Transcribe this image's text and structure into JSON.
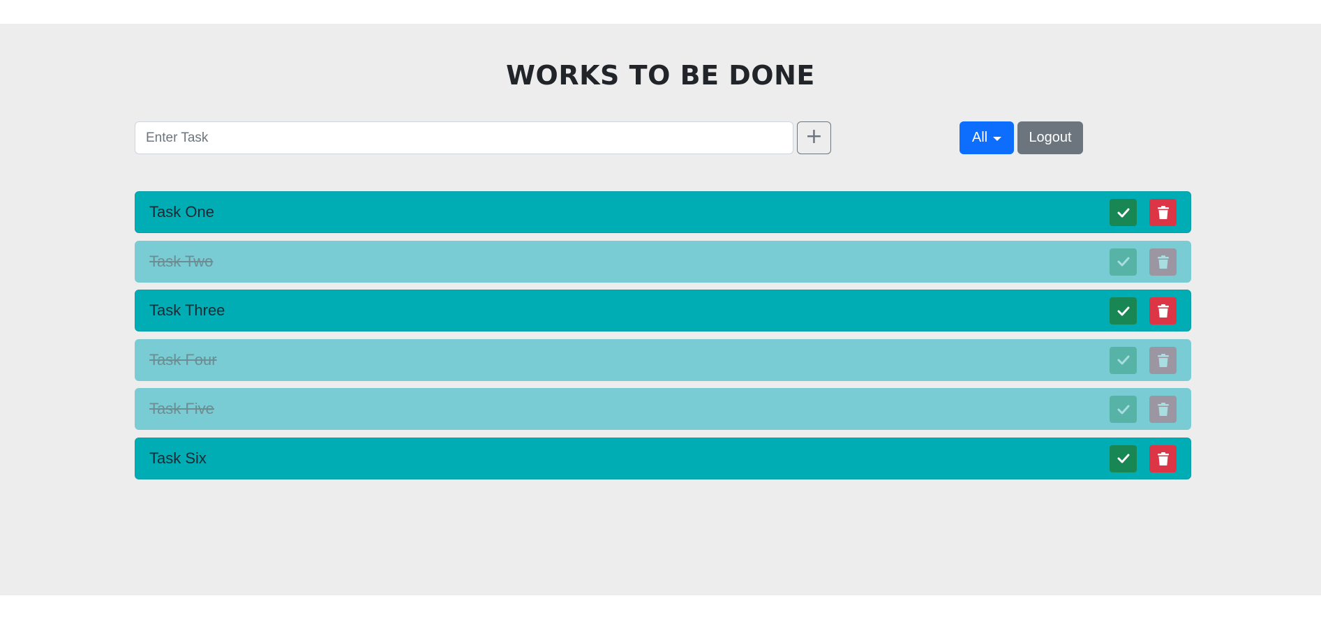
{
  "header": {
    "title": "WORKS TO BE DONE"
  },
  "input": {
    "placeholder": "Enter Task",
    "value": ""
  },
  "toolbar": {
    "add_label": "+",
    "filter_label": "All",
    "logout_label": "Logout"
  },
  "tasks": [
    {
      "label": "Task One",
      "done": false
    },
    {
      "label": "Task Two",
      "done": true
    },
    {
      "label": "Task Three",
      "done": false
    },
    {
      "label": "Task Four",
      "done": true
    },
    {
      "label": "Task Five",
      "done": true
    },
    {
      "label": "Task Six",
      "done": false
    }
  ],
  "icons": {
    "complete": "check-icon",
    "delete": "trash-icon"
  },
  "colors": {
    "background": "#ededed",
    "task_active": "#00adb5",
    "task_done": "#79ccd3",
    "complete_button": "#198754",
    "delete_button": "#dc3545",
    "filter_button": "#0d6efd",
    "logout_button": "#6c757d"
  }
}
